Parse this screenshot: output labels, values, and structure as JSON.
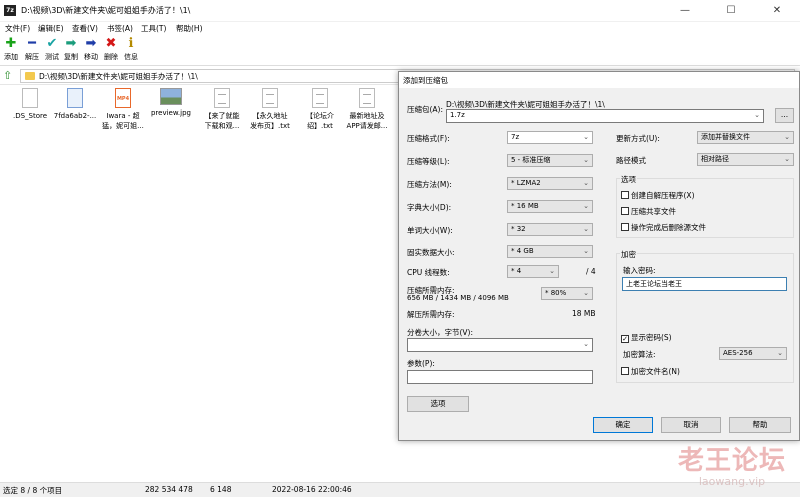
{
  "window": {
    "title": "D:\\视频\\3D\\新建文件夹\\妮可姐姐手办活了！\\1\\",
    "app_icon": "7z",
    "controls": {
      "minimize": "—",
      "maximize": "☐",
      "close": "✕"
    }
  },
  "menu": [
    "文件(F)",
    "编辑(E)",
    "查看(V)",
    "书签(A)",
    "工具(T)",
    "帮助(H)"
  ],
  "toolbar": [
    {
      "label": "添加",
      "icon": "plus-icon",
      "glyph": "✚",
      "color": "#1aa31a"
    },
    {
      "label": "解压",
      "icon": "minus-icon",
      "glyph": "━",
      "color": "#1f3da8"
    },
    {
      "label": "测试",
      "icon": "check-icon",
      "glyph": "✔",
      "color": "#1aa3a3"
    },
    {
      "label": "复制",
      "icon": "copy-arrow-icon",
      "glyph": "➡",
      "color": "#1a9c7c"
    },
    {
      "label": "移动",
      "icon": "move-arrow-icon",
      "glyph": "➡",
      "color": "#1f3da8"
    },
    {
      "label": "删除",
      "icon": "delete-icon",
      "glyph": "✖",
      "color": "#d41818"
    },
    {
      "label": "信息",
      "icon": "info-icon",
      "glyph": "ℹ",
      "color": "#b38a00"
    }
  ],
  "address": "D:\\视频\\3D\\新建文件夹\\妮可姐姐手办活了！\\1\\",
  "files": [
    {
      "name": "DS_Store",
      "line1": ".DS_Store",
      "line2": "",
      "kind": "doc"
    },
    {
      "name": "7fda6ab2",
      "line1": "7fda6ab2-...",
      "line2": "",
      "kind": "img"
    },
    {
      "name": "Iwara",
      "line1": "Iwara - 超",
      "line2": "猛，妮可姐...",
      "kind": "mp4"
    },
    {
      "name": "preview",
      "line1": "preview.jpg",
      "line2": "",
      "kind": "jpg"
    },
    {
      "name": "来了",
      "line1": "【来了就能",
      "line2": "下载和观...",
      "kind": "txt"
    },
    {
      "name": "永久地址",
      "line1": "【永久地址",
      "line2": "发布页】.txt",
      "kind": "txt"
    },
    {
      "name": "论坛介绍",
      "line1": "【论坛介",
      "line2": "绍】.txt",
      "kind": "txt"
    },
    {
      "name": "最新地址",
      "line1": "最新地址及",
      "line2": "APP请发邮...",
      "kind": "txt"
    }
  ],
  "mp4_badge": "MP4",
  "status": {
    "selection": "选定 8 / 8 个项目",
    "size": "282 534 478",
    "packed": "6 148",
    "date": "2022-08-16 22:00:46"
  },
  "dialog": {
    "title": "添加到压缩包",
    "archive_label": "压缩包(A):",
    "archive_path": "D:\\视频\\3D\\新建文件夹\\妮可姐姐手办活了！\\1\\",
    "archive_name": "1.7z",
    "browse": "...",
    "format_label": "压缩格式(F):",
    "format_value": "7z",
    "level_label": "压缩等级(L):",
    "level_value": "5 - 标准压缩",
    "method_label": "压缩方法(M):",
    "method_value": "* LZMA2",
    "dict_label": "字典大小(D):",
    "dict_value": "* 16 MB",
    "word_label": "单词大小(W):",
    "word_value": "* 32",
    "solid_label": "固实数据大小:",
    "solid_value": "* 4 GB",
    "threads_label": "CPU 线程数:",
    "threads_value": "* 4",
    "threads_total": "/ 4",
    "mem_comp_label": "压缩所需内存:",
    "mem_comp_value": "656 MB / 1434 MB / 4096 MB",
    "mem_percent": "* 80%",
    "mem_decomp_label": "解压所需内存:",
    "mem_decomp_value": "18 MB",
    "split_label": "分卷大小，字节(V):",
    "params_label": "参数(P):",
    "options_btn": "选项",
    "update_label": "更新方式(U):",
    "update_value": "添加并替换文件",
    "pathmode_label": "路径模式",
    "pathmode_value": "相对路径",
    "options_group": "选项",
    "opt_sfx": "创建自解压程序(X)",
    "opt_shared": "压缩共享文件",
    "opt_delete": "操作完成后删除源文件",
    "enc_group": "加密",
    "pwd_label": "输入密码:",
    "pwd_value": "上老王论坛当老王",
    "show_pwd": "显示密码(S)",
    "enc_method_label": "加密算法:",
    "enc_method_value": "AES-256",
    "enc_names": "加密文件名(N)",
    "ok": "确定",
    "cancel": "取消",
    "help": "帮助"
  },
  "watermark": {
    "cn": "老王论坛",
    "en": "laowang.vip"
  }
}
